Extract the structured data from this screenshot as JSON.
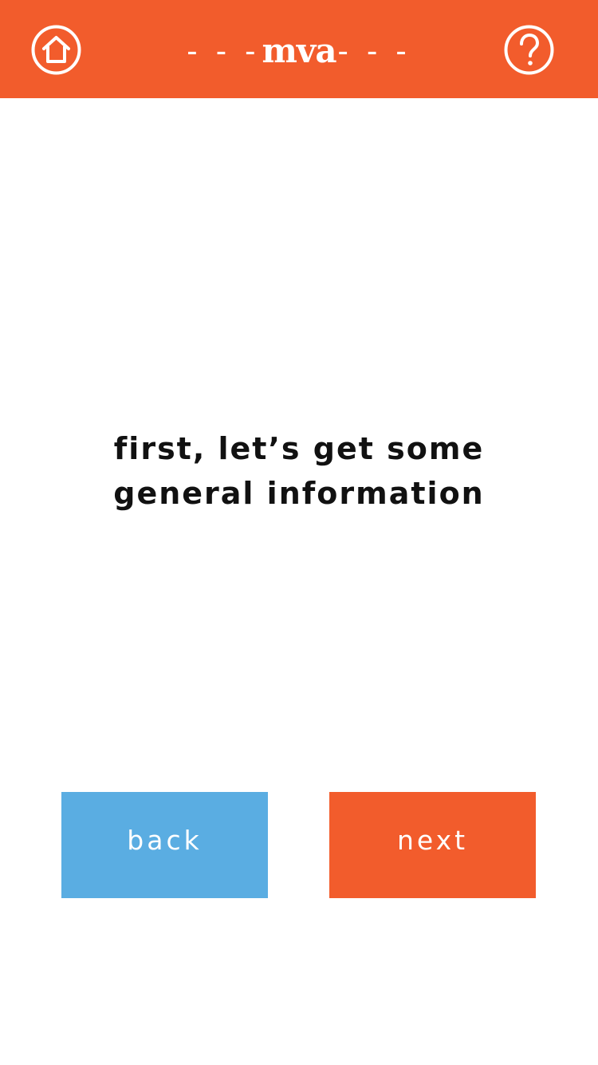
{
  "header": {
    "logo_left_dashes": "- - -",
    "logo_text": "mva",
    "logo_right_dashes": "- - -",
    "home_icon": "home-icon",
    "help_icon": "question-mark-icon"
  },
  "message": {
    "line1": "first, let’s get some",
    "line2": "general information"
  },
  "buttons": {
    "back_label": "back",
    "next_label": "next"
  },
  "colors": {
    "brand_orange": "#f25c2c",
    "back_blue": "#5aade2",
    "background": "#ffffff",
    "text": "#111111"
  }
}
